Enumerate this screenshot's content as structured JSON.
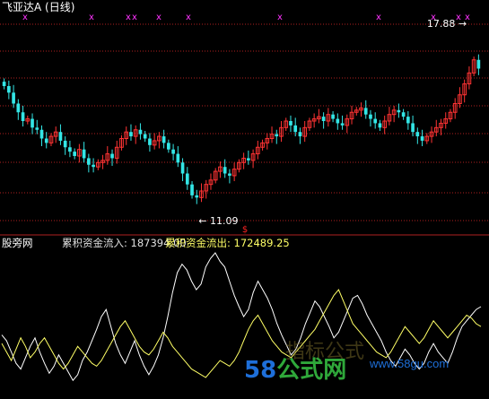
{
  "header": {
    "stock_title": "飞亚达A (日线)",
    "indicator_name": "股旁网",
    "inflow_label": "累积资金流入: 187394.00",
    "outflow_label": "累积资金流出: 172489.25"
  },
  "watermark": {
    "site_cn_num": "58",
    "site_cn_text": "公式网",
    "site_url": "www.58gu.com",
    "faint_text": "指标公式"
  },
  "colors": {
    "up": "#ff3333",
    "down": "#33e6e6",
    "inflow_line": "#ffffff",
    "outflow_line": "#ffff66",
    "grid": "#b02020",
    "cross_marker": "#ff33ff",
    "event_marker": "#ff2222"
  },
  "chart_data": [
    {
      "type": "candlestick",
      "title": "飞亚达A (日线)",
      "annotations": [
        {
          "label": "17.88",
          "value": 17.88,
          "kind": "high"
        },
        {
          "label": "11.09",
          "value": 11.09,
          "kind": "low"
        }
      ],
      "ylim": [
        10.0,
        19.6
      ],
      "grid": true,
      "bar_count": 102,
      "closes": [
        16.4,
        16.1,
        15.6,
        15.2,
        14.8,
        14.9,
        14.5,
        14.4,
        14.0,
        13.8,
        14.1,
        14.3,
        13.9,
        13.6,
        13.4,
        13.2,
        13.5,
        13.1,
        12.8,
        12.7,
        12.9,
        13.0,
        13.3,
        13.1,
        13.6,
        14.0,
        14.3,
        14.1,
        14.4,
        14.2,
        14.0,
        13.7,
        13.9,
        14.1,
        13.8,
        13.5,
        13.3,
        12.9,
        12.4,
        11.9,
        11.4,
        11.3,
        11.6,
        11.9,
        12.1,
        12.5,
        12.7,
        12.4,
        12.3,
        12.6,
        12.9,
        13.1,
        13.0,
        13.3,
        13.6,
        13.8,
        14.0,
        14.2,
        14.1,
        14.5,
        14.8,
        14.6,
        14.3,
        14.1,
        14.5,
        14.8,
        14.9,
        15.0,
        14.8,
        15.1,
        14.9,
        14.7,
        14.6,
        14.9,
        15.2,
        15.3,
        15.4,
        15.1,
        14.9,
        14.7,
        14.5,
        14.8,
        15.1,
        15.3,
        15.2,
        15.0,
        14.7,
        14.3,
        14.1,
        13.9,
        14.1,
        14.3,
        14.5,
        14.7,
        14.9,
        15.2,
        15.6,
        16.0,
        16.5,
        17.0,
        17.6,
        17.2
      ],
      "cross_markers": [
        "x",
        "x",
        "x",
        "x",
        "x",
        "x",
        "x"
      ],
      "event_marker": "$"
    },
    {
      "type": "line",
      "series": [
        {
          "name": "累积资金流入",
          "values": [
            0.42,
            0.38,
            0.3,
            0.22,
            0.18,
            0.26,
            0.34,
            0.4,
            0.3,
            0.22,
            0.15,
            0.2,
            0.28,
            0.22,
            0.16,
            0.1,
            0.14,
            0.24,
            0.3,
            0.38,
            0.46,
            0.55,
            0.6,
            0.48,
            0.36,
            0.28,
            0.22,
            0.3,
            0.38,
            0.28,
            0.2,
            0.14,
            0.2,
            0.28,
            0.4,
            0.55,
            0.72,
            0.86,
            0.92,
            0.88,
            0.8,
            0.74,
            0.78,
            0.9,
            0.96,
            1.0,
            0.94,
            0.9,
            0.8,
            0.7,
            0.62,
            0.55,
            0.6,
            0.72,
            0.8,
            0.74,
            0.68,
            0.6,
            0.5,
            0.42,
            0.35,
            0.28,
            0.32,
            0.4,
            0.5,
            0.58,
            0.66,
            0.62,
            0.55,
            0.48,
            0.4,
            0.44,
            0.52,
            0.6,
            0.68,
            0.7,
            0.64,
            0.56,
            0.5,
            0.44,
            0.38,
            0.3,
            0.24,
            0.2,
            0.26,
            0.32,
            0.28,
            0.22,
            0.18,
            0.22,
            0.3,
            0.36,
            0.3,
            0.26,
            0.22,
            0.3,
            0.4,
            0.48,
            0.52,
            0.56,
            0.6,
            0.62
          ]
        },
        {
          "name": "累积资金流出",
          "values": [
            0.36,
            0.3,
            0.24,
            0.32,
            0.4,
            0.34,
            0.26,
            0.3,
            0.36,
            0.4,
            0.34,
            0.28,
            0.22,
            0.18,
            0.22,
            0.28,
            0.34,
            0.3,
            0.26,
            0.22,
            0.2,
            0.24,
            0.3,
            0.36,
            0.42,
            0.48,
            0.52,
            0.46,
            0.4,
            0.34,
            0.3,
            0.28,
            0.32,
            0.38,
            0.44,
            0.4,
            0.34,
            0.3,
            0.26,
            0.22,
            0.18,
            0.16,
            0.14,
            0.12,
            0.16,
            0.2,
            0.24,
            0.22,
            0.2,
            0.24,
            0.3,
            0.38,
            0.46,
            0.52,
            0.56,
            0.5,
            0.44,
            0.38,
            0.34,
            0.3,
            0.28,
            0.26,
            0.3,
            0.34,
            0.38,
            0.42,
            0.46,
            0.52,
            0.58,
            0.64,
            0.7,
            0.74,
            0.66,
            0.58,
            0.5,
            0.46,
            0.42,
            0.38,
            0.34,
            0.3,
            0.28,
            0.26,
            0.3,
            0.36,
            0.42,
            0.48,
            0.44,
            0.4,
            0.36,
            0.4,
            0.46,
            0.52,
            0.48,
            0.44,
            0.4,
            0.44,
            0.48,
            0.52,
            0.56,
            0.54,
            0.5,
            0.48
          ]
        }
      ]
    }
  ]
}
